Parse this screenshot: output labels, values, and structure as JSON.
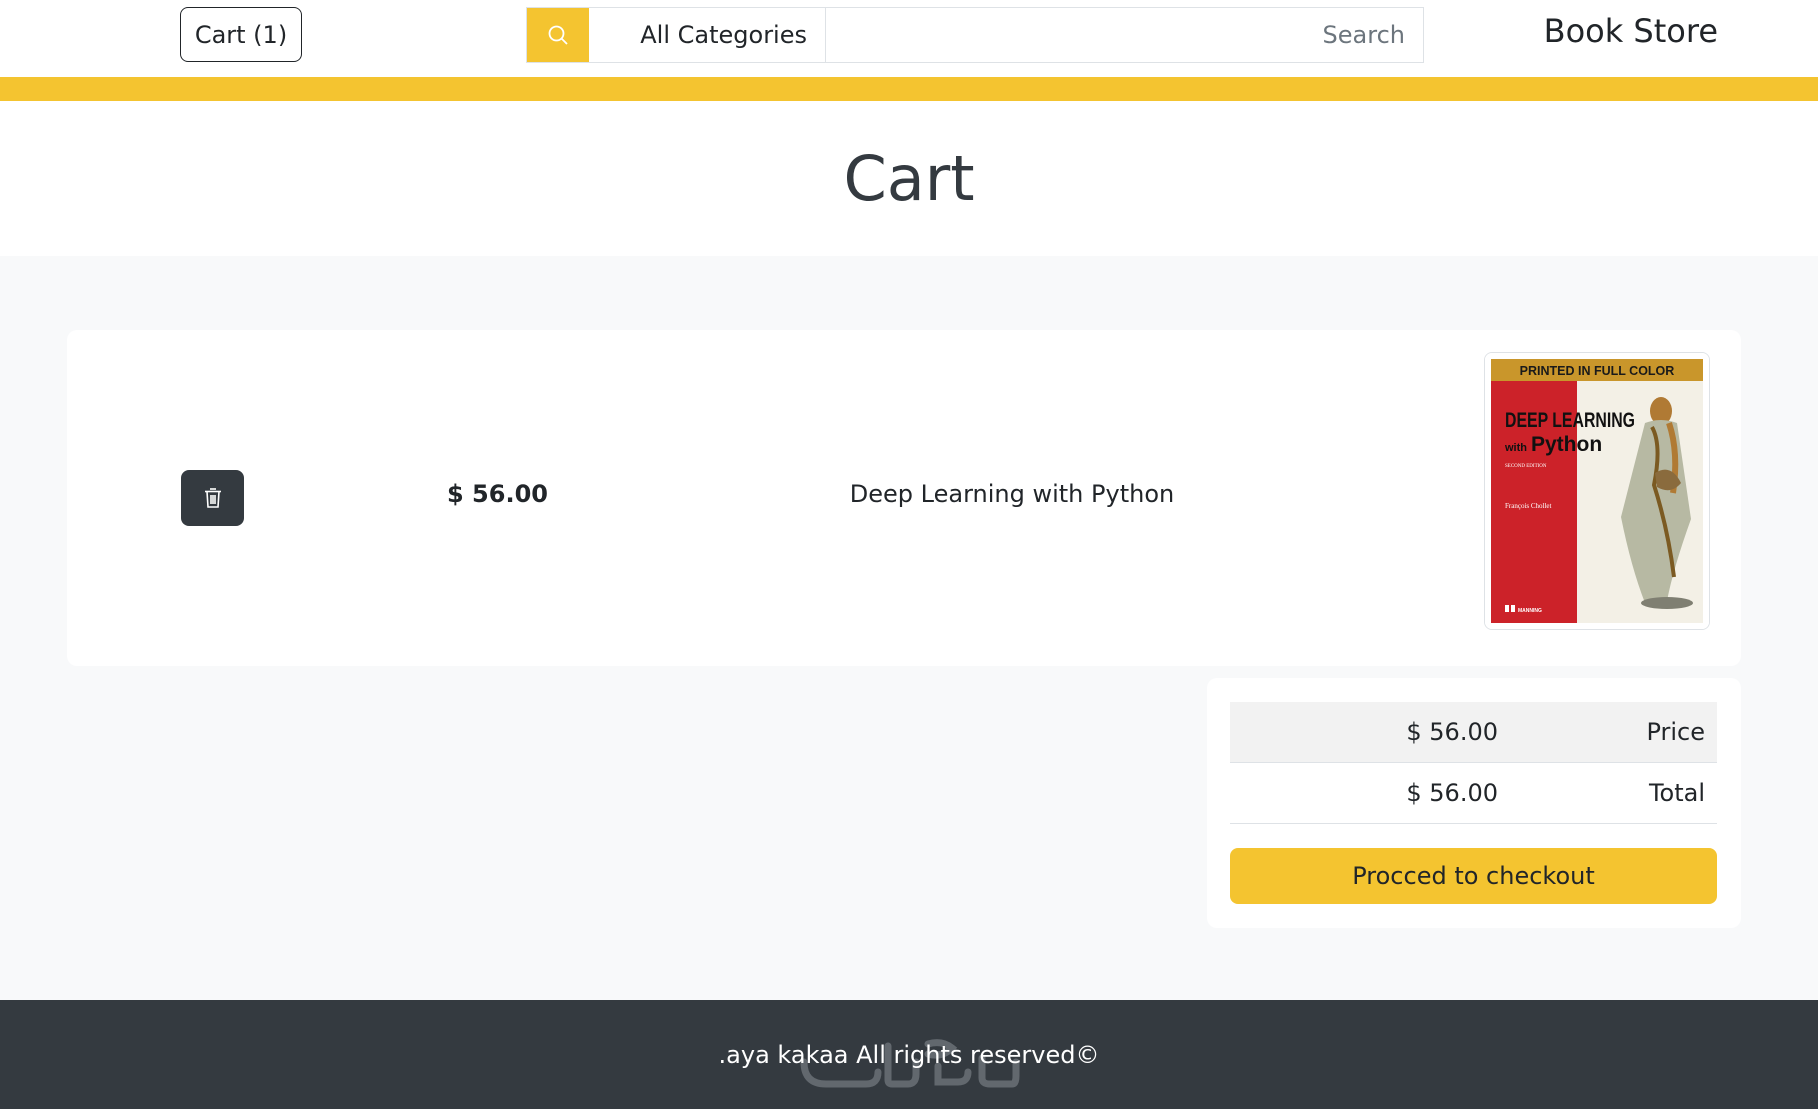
{
  "header": {
    "cart_label": "Cart (1)",
    "category": "All Categories",
    "search_placeholder": "Search",
    "brand": "Book Store"
  },
  "page": {
    "title": "Cart"
  },
  "cart_items": [
    {
      "title": "Deep Learning with Python",
      "price": "$ 56.00",
      "cover": {
        "banner": "PRINTED IN FULL COLOR",
        "line1": "DEEP LEARNING",
        "line2_prefix": "with",
        "line2": "Python",
        "edition": "SECOND EDITION",
        "author": "François Chollet",
        "publisher": "MANNING"
      }
    }
  ],
  "summary": {
    "price_label": "Price",
    "price_value": "$ 56.00",
    "total_label": "Total",
    "total_value": "$ 56.00",
    "checkout_label": "Procced to checkout"
  },
  "footer": {
    "text": ".aya kakaa All rights reserved©"
  },
  "colors": {
    "accent": "#f4c430",
    "dark": "#343a40",
    "background": "#f8f9fa"
  },
  "icons": {
    "search": "search-icon",
    "delete": "trash-icon"
  }
}
